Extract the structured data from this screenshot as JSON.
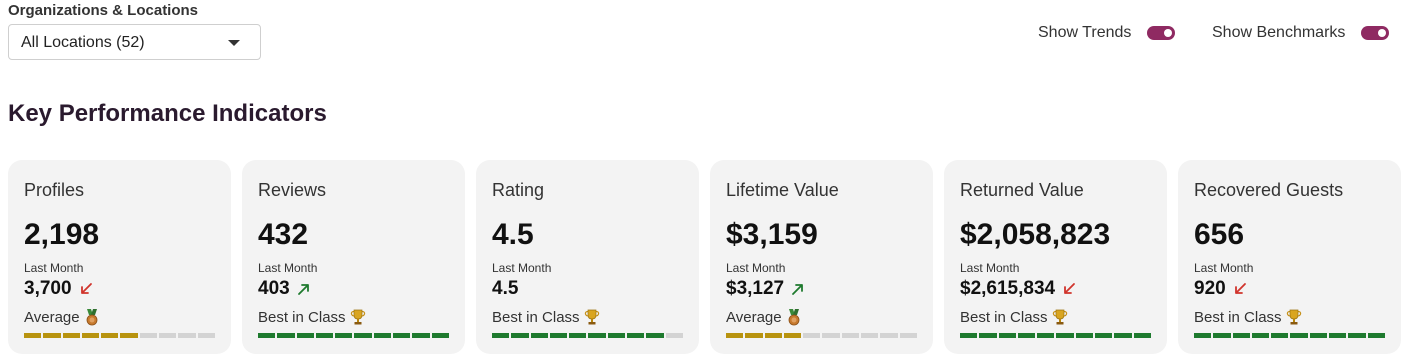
{
  "filter": {
    "label": "Organizations & Locations",
    "selected": "All Locations (52)"
  },
  "toggles": [
    {
      "label": "Show Trends",
      "on": true
    },
    {
      "label": "Show Benchmarks",
      "on": true
    }
  ],
  "section_title": "Key Performance Indicators",
  "colors": {
    "toggle_on": "#8f2a62",
    "average_bar": "#b8930f",
    "best_bar": "#1e7a2e",
    "empty_bar": "#d3d3d3",
    "down_arrow": "#d0342c",
    "up_arrow": "#1e7a2e"
  },
  "cards": [
    {
      "title": "Profiles",
      "value": "2,198",
      "last_label": "Last Month",
      "last_value": "3,700",
      "trend": "down",
      "benchmark": "Average",
      "benchmark_icon": "medal-icon",
      "bar_fill_segments": 6,
      "bar_total_segments": 10
    },
    {
      "title": "Reviews",
      "value": "432",
      "last_label": "Last Month",
      "last_value": "403",
      "trend": "up",
      "benchmark": "Best in Class",
      "benchmark_icon": "trophy-icon",
      "bar_fill_segments": 10,
      "bar_total_segments": 10
    },
    {
      "title": "Rating",
      "value": "4.5",
      "last_label": "Last Month",
      "last_value": "4.5",
      "trend": "none",
      "benchmark": "Best in Class",
      "benchmark_icon": "trophy-icon",
      "bar_fill_segments": 9,
      "bar_total_segments": 10
    },
    {
      "title": "Lifetime Value",
      "value": "$3,159",
      "last_label": "Last Month",
      "last_value": "$3,127",
      "trend": "up",
      "benchmark": "Average",
      "benchmark_icon": "medal-icon",
      "bar_fill_segments": 4,
      "bar_total_segments": 10
    },
    {
      "title": "Returned Value",
      "value": "$2,058,823",
      "last_label": "Last Month",
      "last_value": "$2,615,834",
      "trend": "down",
      "benchmark": "Best in Class",
      "benchmark_icon": "trophy-icon",
      "bar_fill_segments": 10,
      "bar_total_segments": 10
    },
    {
      "title": "Recovered Guests",
      "value": "656",
      "last_label": "Last Month",
      "last_value": "920",
      "trend": "down",
      "benchmark": "Best in Class",
      "benchmark_icon": "trophy-icon",
      "bar_fill_segments": 10,
      "bar_total_segments": 10
    }
  ]
}
